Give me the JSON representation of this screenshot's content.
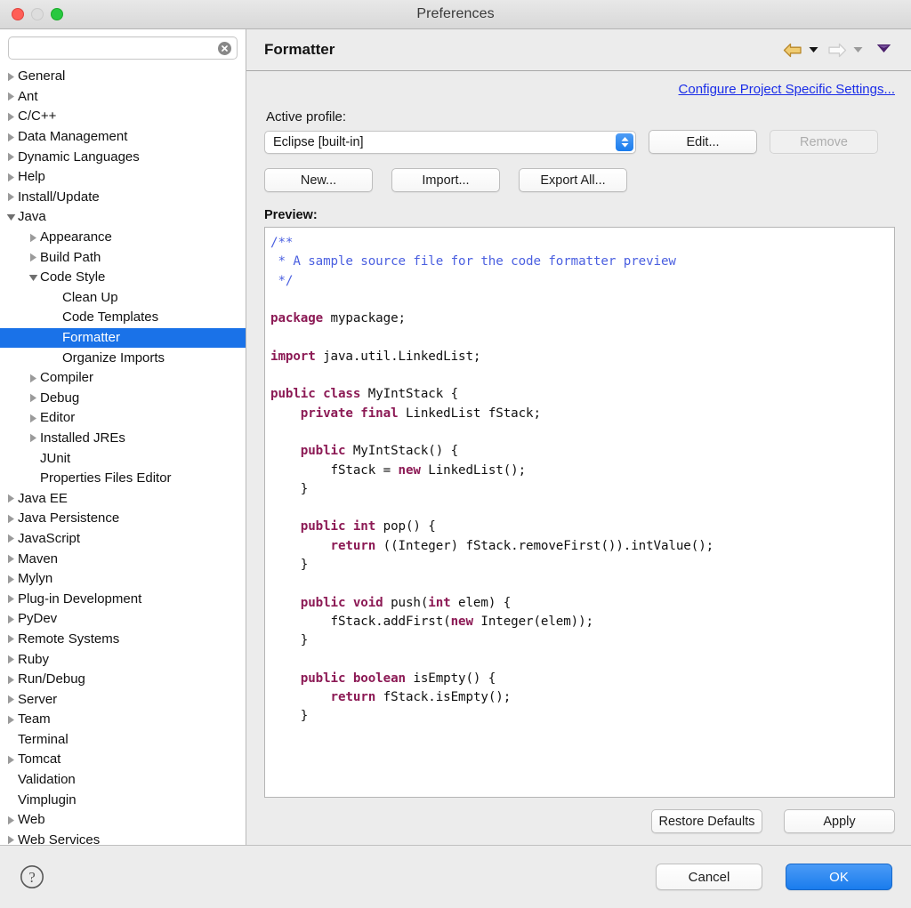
{
  "window": {
    "title": "Preferences",
    "traffic_lights": [
      "close-button",
      "minimize-button",
      "maximize-button"
    ]
  },
  "sidebar": {
    "search": {
      "value": "",
      "placeholder": "",
      "clear_icon": "clear-icon"
    },
    "items": [
      {
        "label": "General",
        "level": 0,
        "twisty": "collapsed",
        "selected": false
      },
      {
        "label": "Ant",
        "level": 0,
        "twisty": "collapsed",
        "selected": false
      },
      {
        "label": "C/C++",
        "level": 0,
        "twisty": "collapsed",
        "selected": false
      },
      {
        "label": "Data Management",
        "level": 0,
        "twisty": "collapsed",
        "selected": false
      },
      {
        "label": "Dynamic Languages",
        "level": 0,
        "twisty": "collapsed",
        "selected": false
      },
      {
        "label": "Help",
        "level": 0,
        "twisty": "collapsed",
        "selected": false
      },
      {
        "label": "Install/Update",
        "level": 0,
        "twisty": "collapsed",
        "selected": false
      },
      {
        "label": "Java",
        "level": 0,
        "twisty": "expanded",
        "selected": false
      },
      {
        "label": "Appearance",
        "level": 1,
        "twisty": "collapsed",
        "selected": false
      },
      {
        "label": "Build Path",
        "level": 1,
        "twisty": "collapsed",
        "selected": false
      },
      {
        "label": "Code Style",
        "level": 1,
        "twisty": "expanded",
        "selected": false
      },
      {
        "label": "Clean Up",
        "level": 2,
        "twisty": "none",
        "selected": false
      },
      {
        "label": "Code Templates",
        "level": 2,
        "twisty": "none",
        "selected": false
      },
      {
        "label": "Formatter",
        "level": 2,
        "twisty": "none",
        "selected": true
      },
      {
        "label": "Organize Imports",
        "level": 2,
        "twisty": "none",
        "selected": false
      },
      {
        "label": "Compiler",
        "level": 1,
        "twisty": "collapsed",
        "selected": false
      },
      {
        "label": "Debug",
        "level": 1,
        "twisty": "collapsed",
        "selected": false
      },
      {
        "label": "Editor",
        "level": 1,
        "twisty": "collapsed",
        "selected": false
      },
      {
        "label": "Installed JREs",
        "level": 1,
        "twisty": "collapsed",
        "selected": false
      },
      {
        "label": "JUnit",
        "level": 1,
        "twisty": "none",
        "selected": false
      },
      {
        "label": "Properties Files Editor",
        "level": 1,
        "twisty": "none",
        "selected": false
      },
      {
        "label": "Java EE",
        "level": 0,
        "twisty": "collapsed",
        "selected": false
      },
      {
        "label": "Java Persistence",
        "level": 0,
        "twisty": "collapsed",
        "selected": false
      },
      {
        "label": "JavaScript",
        "level": 0,
        "twisty": "collapsed",
        "selected": false
      },
      {
        "label": "Maven",
        "level": 0,
        "twisty": "collapsed",
        "selected": false
      },
      {
        "label": "Mylyn",
        "level": 0,
        "twisty": "collapsed",
        "selected": false
      },
      {
        "label": "Plug-in Development",
        "level": 0,
        "twisty": "collapsed",
        "selected": false
      },
      {
        "label": "PyDev",
        "level": 0,
        "twisty": "collapsed",
        "selected": false
      },
      {
        "label": "Remote Systems",
        "level": 0,
        "twisty": "collapsed",
        "selected": false
      },
      {
        "label": "Ruby",
        "level": 0,
        "twisty": "collapsed",
        "selected": false
      },
      {
        "label": "Run/Debug",
        "level": 0,
        "twisty": "collapsed",
        "selected": false
      },
      {
        "label": "Server",
        "level": 0,
        "twisty": "collapsed",
        "selected": false
      },
      {
        "label": "Team",
        "level": 0,
        "twisty": "collapsed",
        "selected": false
      },
      {
        "label": "Terminal",
        "level": 0,
        "twisty": "none",
        "selected": false
      },
      {
        "label": "Tomcat",
        "level": 0,
        "twisty": "collapsed",
        "selected": false
      },
      {
        "label": "Validation",
        "level": 0,
        "twisty": "none",
        "selected": false
      },
      {
        "label": "Vimplugin",
        "level": 0,
        "twisty": "none",
        "selected": false
      },
      {
        "label": "Web",
        "level": 0,
        "twisty": "collapsed",
        "selected": false
      },
      {
        "label": "Web Services",
        "level": 0,
        "twisty": "collapsed",
        "selected": false
      }
    ]
  },
  "panel": {
    "title": "Formatter",
    "nav": {
      "back_icon": "back-arrow-icon",
      "back_menu_icon": "chevron-down-icon",
      "forward_icon": "forward-arrow-icon",
      "forward_menu_icon": "chevron-down-icon",
      "menu_icon": "chevron-down-icon"
    },
    "configure_link": "Configure Project Specific Settings...",
    "active_profile_label": "Active profile:",
    "profile_value": "Eclipse [built-in]",
    "edit_button": "Edit...",
    "remove_button": "Remove",
    "new_button": "New...",
    "import_button": "Import...",
    "export_all_button": "Export All...",
    "preview_label": "Preview:",
    "restore_defaults_button": "Restore Defaults",
    "apply_button": "Apply"
  },
  "code_preview": {
    "lines": [
      [
        {
          "t": "/**",
          "c": "cm"
        }
      ],
      [
        {
          "t": " * A sample source file for the code formatter preview",
          "c": "cm"
        }
      ],
      [
        {
          "t": " */",
          "c": "cm"
        }
      ],
      [
        {
          "t": "",
          "c": ""
        }
      ],
      [
        {
          "t": "package",
          "c": "kw"
        },
        {
          "t": " mypackage;",
          "c": ""
        }
      ],
      [
        {
          "t": "",
          "c": ""
        }
      ],
      [
        {
          "t": "import",
          "c": "kw"
        },
        {
          "t": " java.util.LinkedList;",
          "c": ""
        }
      ],
      [
        {
          "t": "",
          "c": ""
        }
      ],
      [
        {
          "t": "public class",
          "c": "kw"
        },
        {
          "t": " MyIntStack {",
          "c": ""
        }
      ],
      [
        {
          "t": "    private final",
          "c": "kw"
        },
        {
          "t": " LinkedList fStack;",
          "c": ""
        }
      ],
      [
        {
          "t": "",
          "c": ""
        }
      ],
      [
        {
          "t": "    public",
          "c": "kw"
        },
        {
          "t": " MyIntStack() {",
          "c": ""
        }
      ],
      [
        {
          "t": "        fStack = ",
          "c": ""
        },
        {
          "t": "new",
          "c": "kw"
        },
        {
          "t": " LinkedList();",
          "c": ""
        }
      ],
      [
        {
          "t": "    }",
          "c": ""
        }
      ],
      [
        {
          "t": "",
          "c": ""
        }
      ],
      [
        {
          "t": "    public int",
          "c": "kw"
        },
        {
          "t": " pop() {",
          "c": ""
        }
      ],
      [
        {
          "t": "        ",
          "c": ""
        },
        {
          "t": "return",
          "c": "kw"
        },
        {
          "t": " ((Integer) fStack.removeFirst()).intValue();",
          "c": ""
        }
      ],
      [
        {
          "t": "    }",
          "c": ""
        }
      ],
      [
        {
          "t": "",
          "c": ""
        }
      ],
      [
        {
          "t": "    public void",
          "c": "kw"
        },
        {
          "t": " push(",
          "c": ""
        },
        {
          "t": "int",
          "c": "kw"
        },
        {
          "t": " elem) {",
          "c": ""
        }
      ],
      [
        {
          "t": "        fStack.addFirst(",
          "c": ""
        },
        {
          "t": "new",
          "c": "kw"
        },
        {
          "t": " Integer(elem));",
          "c": ""
        }
      ],
      [
        {
          "t": "    }",
          "c": ""
        }
      ],
      [
        {
          "t": "",
          "c": ""
        }
      ],
      [
        {
          "t": "    public boolean",
          "c": "kw"
        },
        {
          "t": " isEmpty() {",
          "c": ""
        }
      ],
      [
        {
          "t": "        ",
          "c": ""
        },
        {
          "t": "return",
          "c": "kw"
        },
        {
          "t": " fStack.isEmpty();",
          "c": ""
        }
      ],
      [
        {
          "t": "    }",
          "c": ""
        }
      ]
    ]
  },
  "dialog_footer": {
    "help_icon": "help-icon",
    "cancel_button": "Cancel",
    "ok_button": "OK"
  },
  "colors": {
    "selection_blue": "#1a72e8",
    "primary_button_blue": "#1a7ced",
    "link_blue": "#1a2de8",
    "comment_blue": "#4a5fe0",
    "keyword_magenta": "#8c1a55",
    "back_arrow_gold": "#e8b84b"
  }
}
